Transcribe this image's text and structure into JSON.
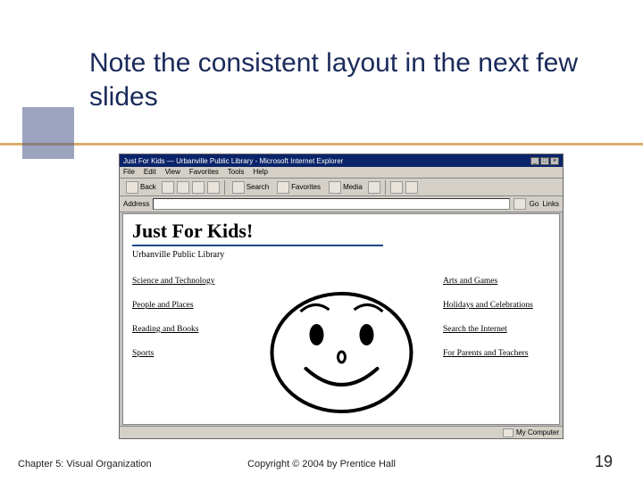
{
  "slide": {
    "title": "Note the consistent layout in the next few slides",
    "chapter": "Chapter 5: Visual Organization",
    "copyright": "Copyright © 2004 by Prentice Hall",
    "page_number": "19"
  },
  "browser": {
    "window_title": "Just For Kids — Urbanville Public Library - Microsoft Internet Explorer",
    "menu": {
      "file": "File",
      "edit": "Edit",
      "view": "View",
      "favorites": "Favorites",
      "tools": "Tools",
      "help": "Help"
    },
    "toolbar": {
      "back": "Back",
      "search": "Search",
      "favorites": "Favorites",
      "media": "Media"
    },
    "addressbar": {
      "label": "Address",
      "go": "Go",
      "links": "Links"
    },
    "status": {
      "zone": "My Computer"
    },
    "win_buttons": {
      "min": "_",
      "max": "□",
      "close": "×"
    }
  },
  "page": {
    "heading": "Just For Kids!",
    "subtitle": "Urbanville Public Library",
    "left_links": [
      "Science and Technology",
      "People and Places",
      "Reading and Books",
      "Sports"
    ],
    "right_links": [
      "Arts and Games",
      "Holidays and Celebrations",
      "Search the Internet",
      "For Parents and Teachers"
    ]
  }
}
